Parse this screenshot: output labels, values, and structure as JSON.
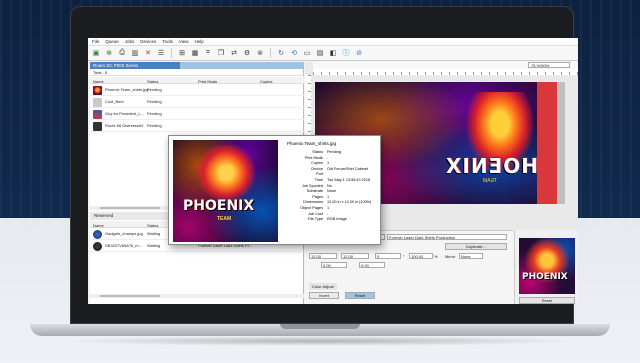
{
  "menu": [
    "File",
    "Queue",
    "Jobs",
    "Devices",
    "Tools",
    "View",
    "Help"
  ],
  "printer": {
    "tab_label": "Roam SC P000 Series",
    "sub_label": "Total : 5"
  },
  "queue_table": {
    "headers": [
      "Name",
      "Status",
      "Print Mode",
      "Copies"
    ],
    "rows": [
      {
        "name": "Phoenix Team_shirts.jpg",
        "status": "Pending"
      },
      {
        "name": "Cold_Beer",
        "status": "Pending"
      },
      {
        "name": "Guy for President_L...",
        "status": "Pending"
      },
      {
        "name": "Route 66 Distressed2",
        "status": "Pending"
      }
    ]
  },
  "lower_tabs": [
    "Reserved",
    "Queue"
  ],
  "lower_table": {
    "headers": [
      "Name",
      "Status",
      "Print Mode",
      "Copies"
    ],
    "rows": [
      {
        "name": "Gadgets_champs.jpg",
        "status": "Waiting",
        "mode": "Forever Laser Dark Shirts Pr..."
      },
      {
        "name": "SB3207V65876_m...",
        "status": "Waiting",
        "mode": "Forever Laser Dark Shirts Pr..."
      }
    ]
  },
  "canvas": {
    "zoom": "75 %/50%",
    "artwork_word": "PHOENIX",
    "artwork_sub": "TEAM"
  },
  "popup": {
    "title": "Phoenix Team_shirts.jpg",
    "art_word": "PHOENIX",
    "art_sub": "TEAM",
    "fields": [
      {
        "k": "Status",
        "v": "Pending"
      },
      {
        "k": "Print Mode",
        "v": "-"
      },
      {
        "k": "Copies",
        "v": "1"
      },
      {
        "k": "Device",
        "v": "Old Forum/Shirt Cabinet"
      },
      {
        "k": "Port",
        "v": ""
      },
      {
        "k": "Time",
        "v": "Tue May  1 13:55:43 2018"
      },
      {
        "k": "Job Spooled",
        "v": "No"
      },
      {
        "k": "Substrate",
        "v": "None"
      },
      {
        "k": "Pages",
        "v": "1"
      },
      {
        "k": "Dimensions",
        "v": "12.00 in x 12.00 in (100%)"
      },
      {
        "k": "Object Pages",
        "v": "1"
      },
      {
        "k": "Job Cost",
        "v": "-"
      },
      {
        "k": "File Type",
        "v": "RGB Image"
      }
    ]
  },
  "props": {
    "mode_value": "Guy for President_L...",
    "profile_value": "Forever Laser Dark Shirts Production",
    "duplicate_label": "Duplicate...",
    "w_value": "12.00",
    "h_value": "12.00",
    "x_value": "0.00",
    "y_value": "0.00",
    "scale_value": "100.00",
    "scale_unit": "%",
    "rotate_value": "0",
    "rotate_unit": "°",
    "mirror_value": "None",
    "mirror_label": "Mirror",
    "tab1": "Color Adjust",
    "btn_invert": "Invert",
    "btn_reset": "Reset"
  },
  "preview": {
    "word": "PHOENIX",
    "reset_label": "Reset"
  }
}
